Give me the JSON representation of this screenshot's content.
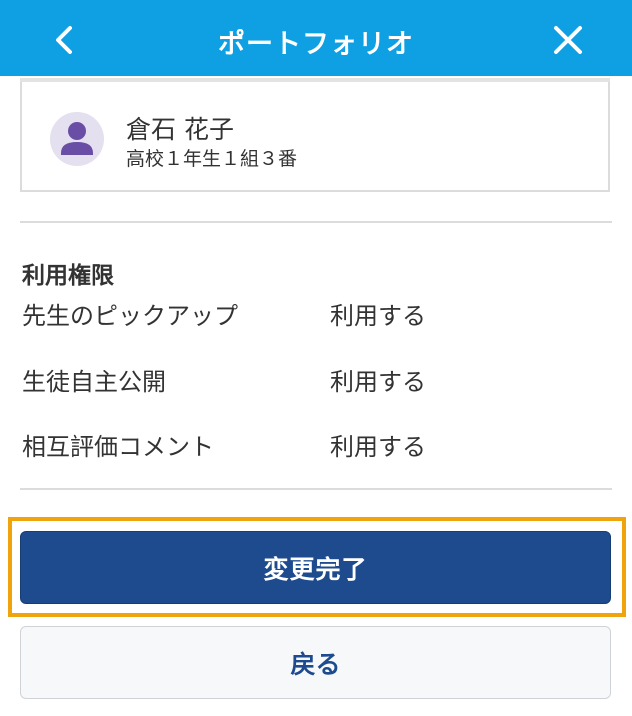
{
  "header": {
    "title": "ポートフォリオ",
    "back_icon": "chevron-left-icon",
    "close_icon": "close-icon",
    "background_color": "#0f9fe3"
  },
  "student": {
    "name": "倉石 花子",
    "class_info": "高校１年生１組３番",
    "avatar_icon": "user-silhouette-icon",
    "avatar_color": "#6a4ea6"
  },
  "permissions": {
    "title": "利用権限",
    "items": [
      {
        "label": "先生のピックアップ",
        "value": "利用する"
      },
      {
        "label": "生徒自主公開",
        "value": "利用する"
      },
      {
        "label": "相互評価コメント",
        "value": "利用する"
      }
    ]
  },
  "actions": {
    "complete_label": "変更完了",
    "back_label": "戻る",
    "primary_color": "#1e4b8e",
    "highlight_color": "#f0a30a"
  }
}
